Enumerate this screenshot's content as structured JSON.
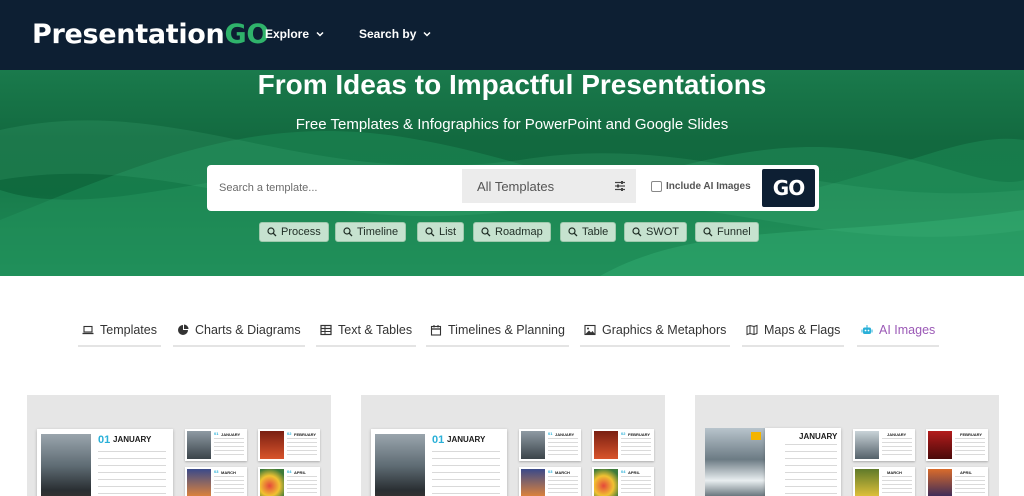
{
  "header": {
    "logo_main": "Presentation",
    "logo_accent": "GO",
    "nav": [
      {
        "label": "Explore"
      },
      {
        "label": "Search by"
      }
    ]
  },
  "hero": {
    "title": "From Ideas to Impactful Presentations",
    "subtitle": "Free Templates & Infographics for PowerPoint and Google Slides",
    "search": {
      "placeholder": "Search a template...",
      "value": "",
      "category_select": "All Templates",
      "include_ai_label": "Include AI Images",
      "include_ai_checked": false,
      "go_label": "GO"
    },
    "chips": [
      "Process",
      "Timeline",
      "List",
      "Roadmap",
      "Table",
      "SWOT",
      "Funnel"
    ]
  },
  "categories": [
    {
      "label": "Templates",
      "icon": "laptop-icon",
      "active": false
    },
    {
      "label": "Charts & Diagrams",
      "icon": "pie-chart-icon",
      "active": false
    },
    {
      "label": "Text & Tables",
      "icon": "table-icon",
      "active": false
    },
    {
      "label": "Timelines & Planning",
      "icon": "calendar-icon",
      "active": false
    },
    {
      "label": "Graphics & Metaphors",
      "icon": "image-icon",
      "active": false
    },
    {
      "label": "Maps & Flags",
      "icon": "map-icon",
      "active": false
    },
    {
      "label": "AI Images",
      "icon": "robot-icon",
      "active": true
    }
  ],
  "cards": [
    {
      "main_num": "01",
      "main_month": "JANUARY",
      "minis": [
        {
          "num": "01",
          "month": "JANUARY"
        },
        {
          "num": "02",
          "month": "FEBRUARY"
        },
        {
          "num": "03",
          "month": "MARCH"
        },
        {
          "num": "04",
          "month": "APRIL"
        }
      ]
    },
    {
      "main_num": "01",
      "main_month": "JANUARY",
      "minis": [
        {
          "num": "01",
          "month": "JANUARY"
        },
        {
          "num": "02",
          "month": "FEBRUARY"
        },
        {
          "num": "03",
          "month": "MARCH"
        },
        {
          "num": "04",
          "month": "APRIL"
        }
      ]
    },
    {
      "main_month": "JANUARY",
      "minis": [
        {
          "month": "JANUARY"
        },
        {
          "month": "FEBRUARY"
        },
        {
          "month": "MARCH"
        },
        {
          "month": "APRIL"
        }
      ]
    }
  ],
  "colors": {
    "header_bg": "#0d1f33",
    "brand_green": "#2fb36b",
    "hero_green": "#12693f",
    "chip_bg": "#c6e2cf",
    "active_tab": "#9b59b6",
    "accent_blue": "#2ab0d8"
  }
}
